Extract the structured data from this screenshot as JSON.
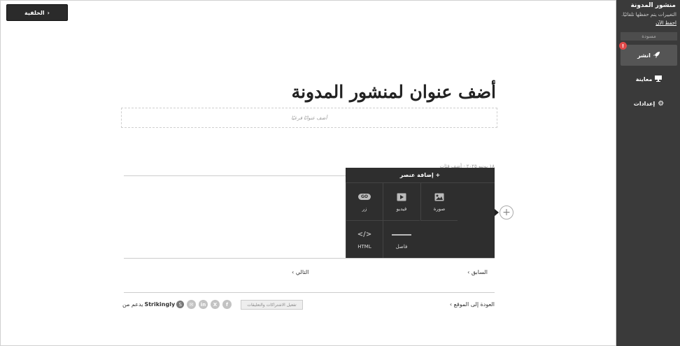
{
  "topbar": {
    "back_label": "الخلفية"
  },
  "sidebar": {
    "title": "منشور المدونة",
    "note": "التغييرات يتم حفظها تلقائيًا.",
    "save_now": "احفظ الآن",
    "draft_label": "مسودة",
    "publish_label": "انشر",
    "publish_badge": "!",
    "preview_label": "معاينة",
    "settings_label": "إعدادات"
  },
  "post": {
    "title": "أضف عنوان لمنشور المدونة",
    "subtitle_placeholder": "أضف عنوانًا فرعيًا",
    "date": "١٨ يونيو ٢٠٢٥ · أضف فئات"
  },
  "add_panel": {
    "title": "+ إضافة عنصر",
    "items": [
      {
        "label": "صورة",
        "icon": "image-icon"
      },
      {
        "label": "فيديو",
        "icon": "video-icon"
      },
      {
        "label": "زر",
        "icon": "button-icon",
        "icon_text": "GO"
      },
      {
        "label": "فاصل",
        "icon": "divider-icon"
      },
      {
        "label": "HTML",
        "icon": "code-icon",
        "icon_text": "</>"
      }
    ]
  },
  "post_nav": {
    "prev": "السابق",
    "next": "التالي"
  },
  "footer": {
    "back_to_site": "العودة إلى الموقع",
    "subscriptions_button": "تفعيل الاشتراكات والتعليقات",
    "social": [
      {
        "name": "facebook-icon",
        "glyph": "f"
      },
      {
        "name": "x-icon",
        "glyph": "X"
      },
      {
        "name": "linkedin-icon",
        "glyph": "in"
      },
      {
        "name": "email-icon",
        "glyph": "✉"
      }
    ],
    "powered_prefix": "يدعم من",
    "powered_brand": "Strikingly",
    "brand_glyph": "S"
  }
}
